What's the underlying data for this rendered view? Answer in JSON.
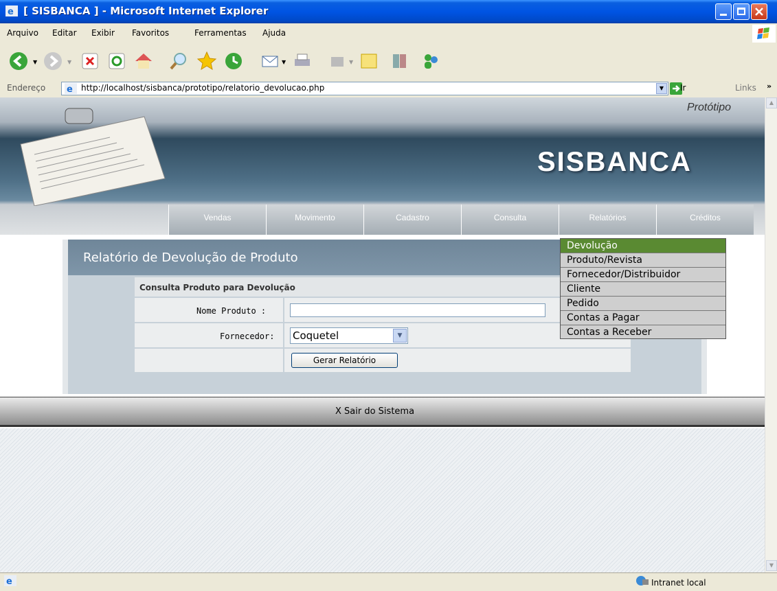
{
  "window": {
    "title": "[ SISBANCA ] - Microsoft Internet Explorer"
  },
  "menu": [
    "Arquivo",
    "Editar",
    "Exibir",
    "Favoritos",
    "Ferramentas",
    "Ajuda"
  ],
  "address": {
    "label": "Endereço",
    "url": "http://localhost/sisbanca/prototipo/relatorio_devolucao.php",
    "go": "Ir",
    "links": "Links"
  },
  "header": {
    "tag": "Protótipo",
    "brand": "SISBANCA"
  },
  "nav": [
    "Vendas",
    "Movimento",
    "Cadastro",
    "Consulta",
    "Relatórios",
    "Créditos"
  ],
  "dropdown": {
    "items": [
      "Devolução",
      "Produto/Revista",
      "Fornecedor/Distribuidor",
      "Cliente",
      "Pedido",
      "Contas a Pagar",
      "Contas a Receber"
    ],
    "active_index": 0
  },
  "page": {
    "title": "Relatório de Devolução de Produto",
    "form_title": "Consulta Produto para Devolução",
    "nome_label": "Nome Produto :",
    "nome_value": "",
    "fornecedor_label": "Fornecedor:",
    "fornecedor_value": "Coquetel",
    "submit": "Gerar Relatório"
  },
  "footer": {
    "logout": "X Sair do Sistema"
  },
  "status": {
    "zone": "Intranet local"
  },
  "colors": {
    "xp_blue": "#0054e3",
    "menu_active": "#5a8a32",
    "panel_header": "#7a91a4"
  }
}
